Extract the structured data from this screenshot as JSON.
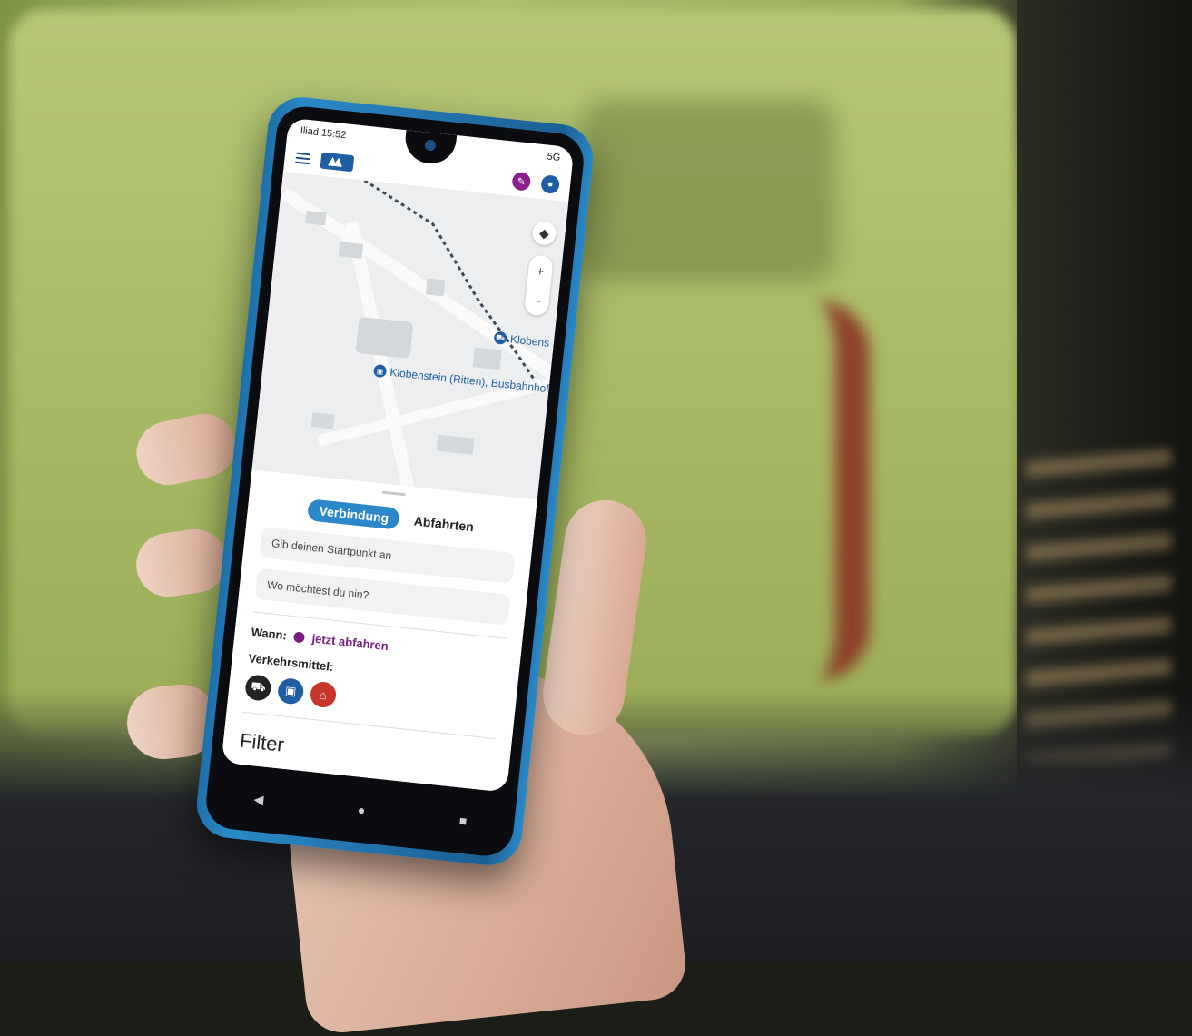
{
  "status_bar": {
    "carrier_time": "Iliad 15:52",
    "signal": "5G"
  },
  "map": {
    "stop_main": "Klobenstein (Ritten), Busbahnhof",
    "stop_secondary": "Klobens",
    "zoom_in": "+",
    "zoom_out": "−"
  },
  "tabs": {
    "active": "Verbindung",
    "inactive": "Abfahrten"
  },
  "inputs": {
    "start_placeholder": "Gib deinen Startpunkt an",
    "destination_placeholder": "Wo möchtest du hin?"
  },
  "when": {
    "label": "Wann:",
    "value": "jetzt abfahren"
  },
  "transport": {
    "label": "Verkehrsmittel:",
    "modes": [
      "train-icon",
      "bus-icon",
      "cable-car-icon"
    ]
  },
  "filter": {
    "title": "Filter"
  },
  "nav": {
    "back": "◀",
    "home": "●",
    "recent": "■"
  }
}
